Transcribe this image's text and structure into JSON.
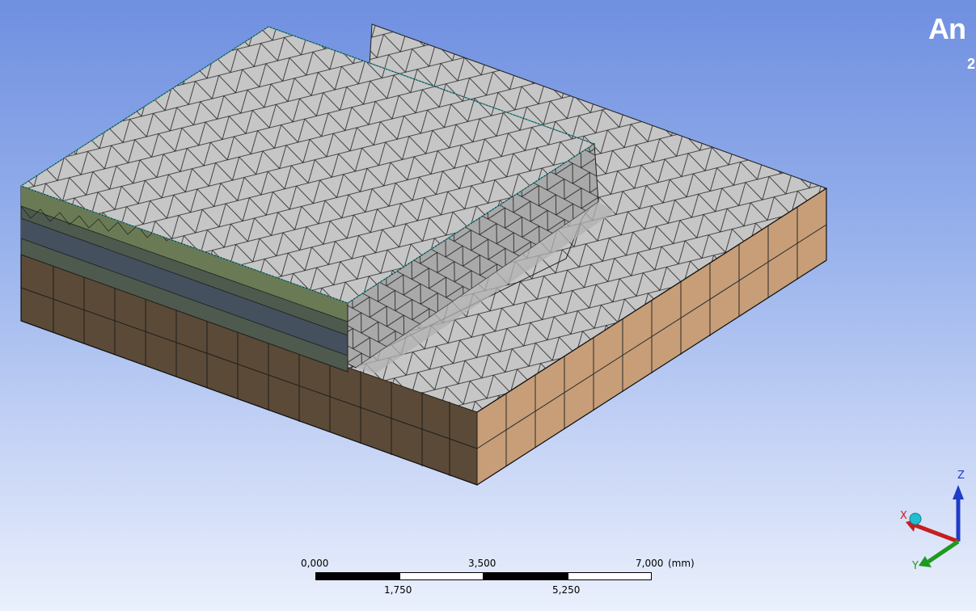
{
  "viewport": {
    "brand_text": "An",
    "brand_sub_text": "2",
    "background_top": "#6f8fe0",
    "background_bottom": "#eaf0fc"
  },
  "model": {
    "mesh_surface_color": "#c4c4c4",
    "soil_front_color": "#5b4a37",
    "soil_side_color": "#c79e78",
    "mesh_line_color": "#1a1a1a",
    "edge_highlight_color": "#1fa2a6"
  },
  "scale_bar": {
    "top_labels": [
      "0,000",
      "3,500",
      "7,000"
    ],
    "unit": "(mm)",
    "bottom_labels": [
      "1,750",
      "5,250"
    ]
  },
  "triad": {
    "z_label": "Z",
    "x_label": "X",
    "y_label": "Y",
    "z_color": "#1f3cc8",
    "x_color": "#c81e1e",
    "y_color": "#1e9a1e",
    "origin_color": "#1ebfcf"
  }
}
